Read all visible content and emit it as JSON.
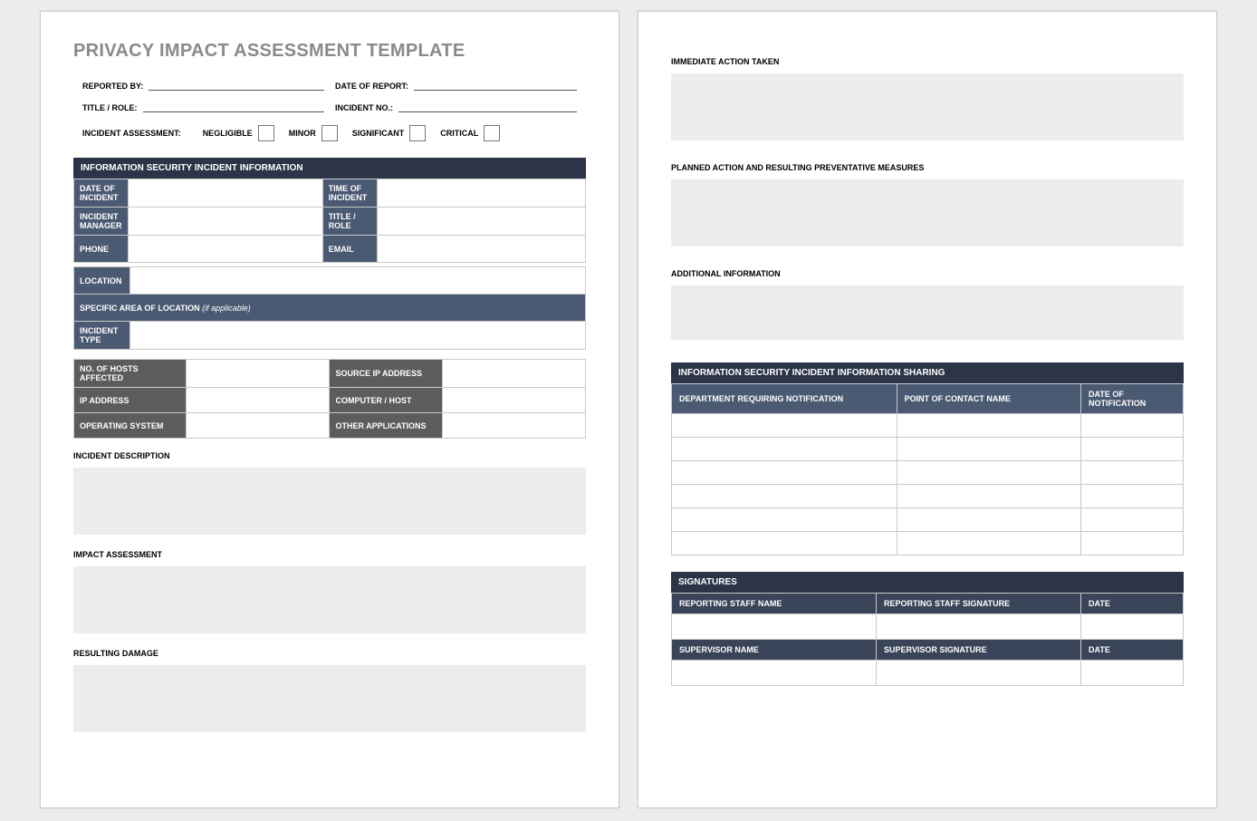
{
  "title": "PRIVACY IMPACT ASSESSMENT TEMPLATE",
  "header": {
    "reported_by_label": "REPORTED BY:",
    "date_of_report_label": "DATE OF REPORT:",
    "title_role_label": "TITLE / ROLE:",
    "incident_no_label": "INCIDENT NO.:",
    "reported_by": "",
    "date_of_report": "",
    "title_role": "",
    "incident_no": ""
  },
  "assessment": {
    "label": "INCIDENT ASSESSMENT:",
    "negligible": "NEGLIGIBLE",
    "minor": "MINOR",
    "significant": "SIGNIFICANT",
    "critical": "CRITICAL"
  },
  "info_section_title": "INFORMATION SECURITY INCIDENT INFORMATION",
  "info": {
    "date_of_incident_label": "DATE OF INCIDENT",
    "time_of_incident_label": "TIME OF INCIDENT",
    "incident_manager_label": "INCIDENT MANAGER",
    "title_role_label": "TITLE / ROLE",
    "phone_label": "PHONE",
    "email_label": "EMAIL",
    "location_label": "LOCATION",
    "specific_area_label": "SPECIFIC AREA OF LOCATION",
    "specific_area_note": " (if applicable)",
    "incident_type_label": "INCIDENT TYPE",
    "date_of_incident": "",
    "time_of_incident": "",
    "incident_manager": "",
    "title_role": "",
    "phone": "",
    "email": "",
    "location": "",
    "specific_area": "",
    "incident_type": ""
  },
  "tech": {
    "hosts_affected_label": "NO. OF HOSTS AFFECTED",
    "source_ip_label": "SOURCE IP ADDRESS",
    "ip_address_label": "IP ADDRESS",
    "computer_host_label": "COMPUTER / HOST",
    "os_label": "OPERATING SYSTEM",
    "other_apps_label": "OTHER APPLICATIONS",
    "hosts_affected": "",
    "source_ip": "",
    "ip_address": "",
    "computer_host": "",
    "os": "",
    "other_apps": ""
  },
  "free": {
    "incident_description_label": "INCIDENT DESCRIPTION",
    "impact_assessment_label": "IMPACT ASSESSMENT",
    "resulting_damage_label": "RESULTING DAMAGE",
    "immediate_action_label": "IMMEDIATE ACTION TAKEN",
    "planned_action_label": "PLANNED ACTION AND RESULTING PREVENTATIVE MEASURES",
    "additional_info_label": "ADDITIONAL INFORMATION",
    "incident_description": "",
    "impact_assessment": "",
    "resulting_damage": "",
    "immediate_action": "",
    "planned_action": "",
    "additional_info": ""
  },
  "sharing": {
    "section_title": "INFORMATION SECURITY INCIDENT INFORMATION SHARING",
    "col_department": "DEPARTMENT REQUIRING NOTIFICATION",
    "col_contact": "POINT OF CONTACT NAME",
    "col_date": "DATE OF NOTIFICATION",
    "rows": [
      {
        "dept": "",
        "contact": "",
        "date": ""
      },
      {
        "dept": "",
        "contact": "",
        "date": ""
      },
      {
        "dept": "",
        "contact": "",
        "date": ""
      },
      {
        "dept": "",
        "contact": "",
        "date": ""
      },
      {
        "dept": "",
        "contact": "",
        "date": ""
      },
      {
        "dept": "",
        "contact": "",
        "date": ""
      }
    ]
  },
  "signatures": {
    "section_title": "SIGNATURES",
    "reporting_name_label": "REPORTING STAFF NAME",
    "reporting_sig_label": "REPORTING STAFF SIGNATURE",
    "date_label": "DATE",
    "supervisor_name_label": "SUPERVISOR NAME",
    "supervisor_sig_label": "SUPERVISOR SIGNATURE",
    "reporting_name": "",
    "reporting_sig": "",
    "reporting_date": "",
    "supervisor_name": "",
    "supervisor_sig": "",
    "supervisor_date": ""
  }
}
